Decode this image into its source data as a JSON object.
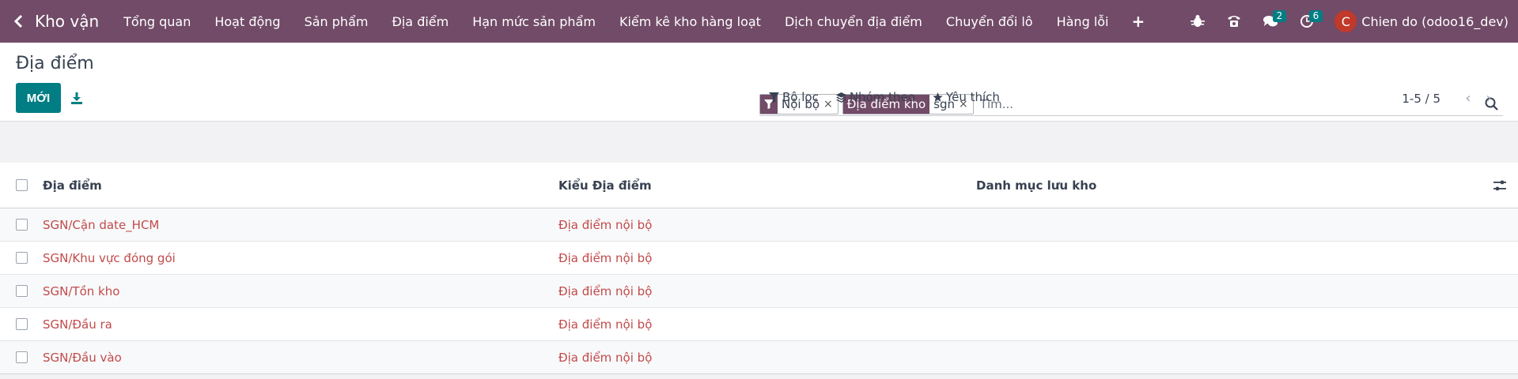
{
  "navbar": {
    "app_name": "Kho vận",
    "menu": [
      "Tổng quan",
      "Hoạt động",
      "Sản phẩm",
      "Địa điểm",
      "Hạn mức sản phẩm",
      "Kiểm kê kho hàng loạt",
      "Dịch chuyển địa điểm",
      "Chuyển đổi lô",
      "Hàng lỗi"
    ],
    "messages_count": "2",
    "activities_count": "6",
    "user_initial": "C",
    "user_name": "Chien do (odoo16_dev)"
  },
  "control": {
    "title": "Địa điểm",
    "new_button": "MỚI",
    "search": {
      "facets": [
        {
          "label": "",
          "value": "Nội bộ",
          "icon": "filter-icon"
        },
        {
          "label": "Địa điểm kho",
          "value": "sgn"
        }
      ],
      "placeholder": "Tìm..."
    },
    "filters_label": "Bộ lọc",
    "group_by_label": "Nhóm theo",
    "favorites_label": "Yêu thích",
    "pager": "1-5 / 5"
  },
  "table": {
    "columns": [
      "Địa điểm",
      "Kiểu Địa điểm",
      "Danh mục lưu kho"
    ],
    "rows": [
      {
        "location": "SGN/Cận date_HCM",
        "type": "Địa điểm nội bộ",
        "category": ""
      },
      {
        "location": "SGN/Khu vực đóng gói",
        "type": "Địa điểm nội bộ",
        "category": ""
      },
      {
        "location": "SGN/Tồn kho",
        "type": "Địa điểm nội bộ",
        "category": ""
      },
      {
        "location": "SGN/Đầu ra",
        "type": "Địa điểm nội bộ",
        "category": ""
      },
      {
        "location": "SGN/Đầu vào",
        "type": "Địa điểm nội bộ",
        "category": ""
      }
    ]
  },
  "colors": {
    "brand": "#714b67",
    "primary_button": "#017e84",
    "link": "#c24a4a",
    "avatar": "#c0392b"
  }
}
